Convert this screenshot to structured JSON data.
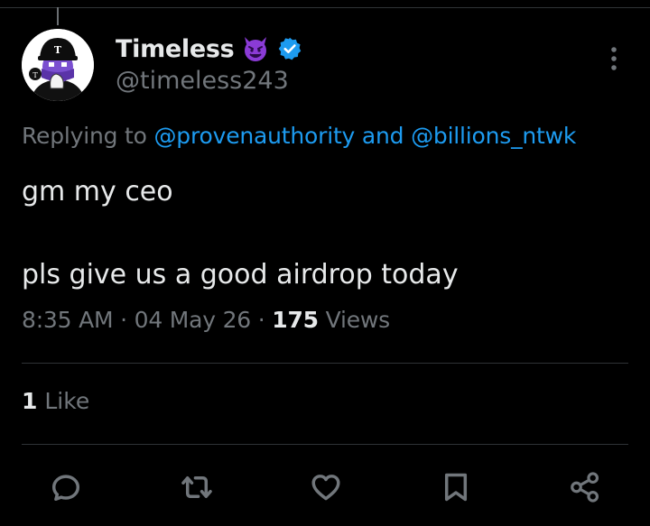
{
  "tweet": {
    "author": {
      "display_name": "Timeless",
      "handle": "@timeless243",
      "badge_emoji": "smiling-face-with-horns",
      "verified": true,
      "avatar_caption": "T"
    },
    "reply_context": {
      "prefix": "Replying to",
      "mention_1": "@provenauthority",
      "joiner": "and",
      "mention_2": "@billions_ntwk"
    },
    "text": {
      "line_1": "gm my ceo",
      "line_2": "pls give us a good airdrop today"
    },
    "meta": {
      "time": "8:35 AM",
      "separator": "·",
      "date": "04 May 26",
      "views_count": "175",
      "views_label": "Views"
    },
    "engagement": {
      "likes_count": "1",
      "likes_label": "Like"
    },
    "actions": [
      {
        "name": "reply",
        "icon": "reply-icon"
      },
      {
        "name": "repost",
        "icon": "repost-icon"
      },
      {
        "name": "like",
        "icon": "heart-icon"
      },
      {
        "name": "bookmark",
        "icon": "bookmark-icon"
      },
      {
        "name": "share",
        "icon": "share-icon"
      }
    ]
  },
  "colors": {
    "background": "#000000",
    "text_primary": "#e7e9ea",
    "text_secondary": "#71767b",
    "link": "#1d9bf0",
    "divider": "#2f3336",
    "verified": "#1d9bf0",
    "emoji_purple": "#8b3bd6"
  }
}
